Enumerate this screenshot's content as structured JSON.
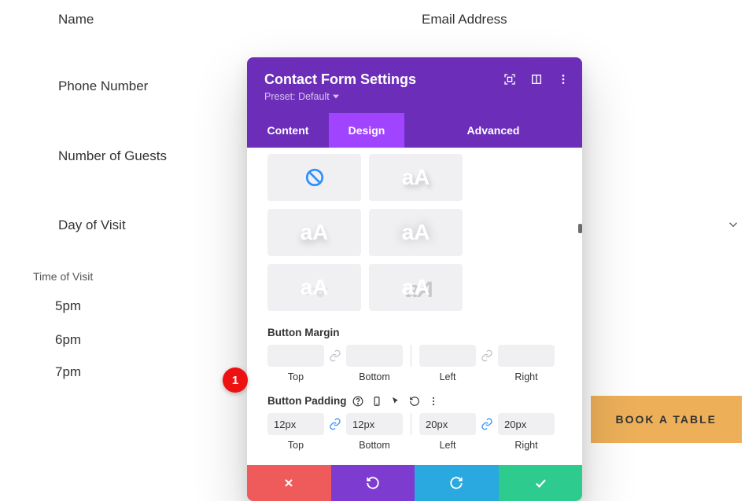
{
  "form": {
    "name": "Name",
    "email": "Email Address",
    "phone": "Phone Number",
    "guests": "Number of Guests",
    "day": "Day of Visit",
    "time_label": "Time of Visit",
    "times": [
      "5pm",
      "6pm",
      "7pm"
    ]
  },
  "book_button": "BOOK A TABLE",
  "modal": {
    "title": "Contact Form Settings",
    "preset": "Preset: Default",
    "tabs": {
      "content": "Content",
      "design": "Design",
      "advanced": "Advanced"
    },
    "icon_label": "aA",
    "margin": {
      "label": "Button Margin",
      "top": {
        "value": "",
        "label": "Top"
      },
      "bottom": {
        "value": "",
        "label": "Bottom"
      },
      "left": {
        "value": "",
        "label": "Left"
      },
      "right": {
        "value": "",
        "label": "Right"
      }
    },
    "padding": {
      "label": "Button Padding",
      "top": {
        "value": "12px",
        "label": "Top"
      },
      "bottom": {
        "value": "12px",
        "label": "Bottom"
      },
      "left": {
        "value": "20px",
        "label": "Left"
      },
      "right": {
        "value": "20px",
        "label": "Right"
      }
    }
  },
  "annotation": {
    "badge1": "1"
  }
}
